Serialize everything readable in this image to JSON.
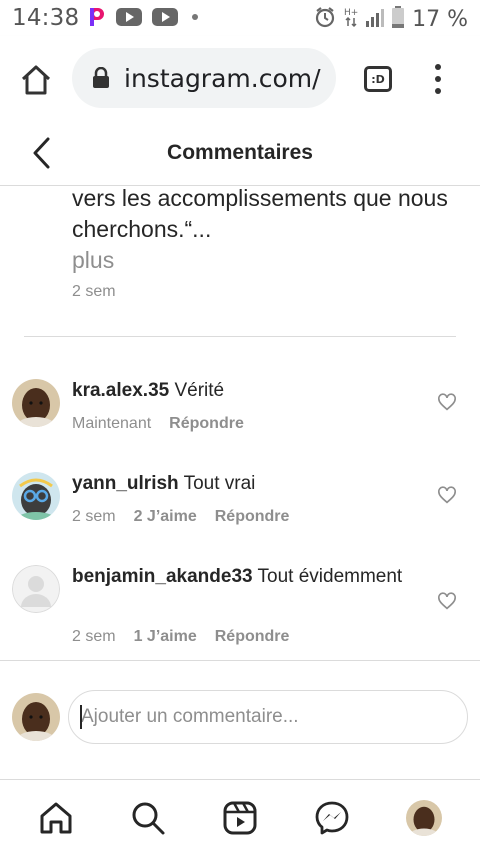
{
  "status_bar": {
    "time": "14:38",
    "battery_percent": "17 %",
    "icons": [
      "picsart-icon",
      "youtube-icon",
      "youtube-icon",
      "notification-dot-icon",
      "alarm-icon",
      "hplus-signal-icon",
      "cell-signal-icon",
      "battery-icon"
    ]
  },
  "browser": {
    "url": "instagram.com/",
    "tab_label": ":D"
  },
  "header": {
    "title": "Commentaires"
  },
  "caption": {
    "text": "vers les accomplissements que nous cherchons.“...",
    "more_label": "plus",
    "time": "2 sem"
  },
  "comments": [
    {
      "username": "kra.alex.35",
      "text": "Vérité",
      "time": "Maintenant",
      "likes": "",
      "reply_label": "Répondre"
    },
    {
      "username": "yann_ulrish",
      "text": "Tout vrai",
      "time": "2 sem",
      "likes": "2 J’aime",
      "reply_label": "Répondre"
    },
    {
      "username": "benjamin_akande33",
      "text": "Tout évidemment",
      "time": "2 sem",
      "likes": "1 J’aime",
      "reply_label": "Répondre"
    }
  ],
  "add_comment": {
    "placeholder": "Ajouter un commentaire..."
  },
  "bottom_nav": {
    "items": [
      "home-icon",
      "search-icon",
      "reels-icon",
      "messenger-icon",
      "profile-avatar"
    ]
  },
  "colors": {
    "text": "#262626",
    "secondary_text": "#8e8e8e",
    "divider": "#dbdbdb",
    "url_pill": "#f1f3f4"
  }
}
